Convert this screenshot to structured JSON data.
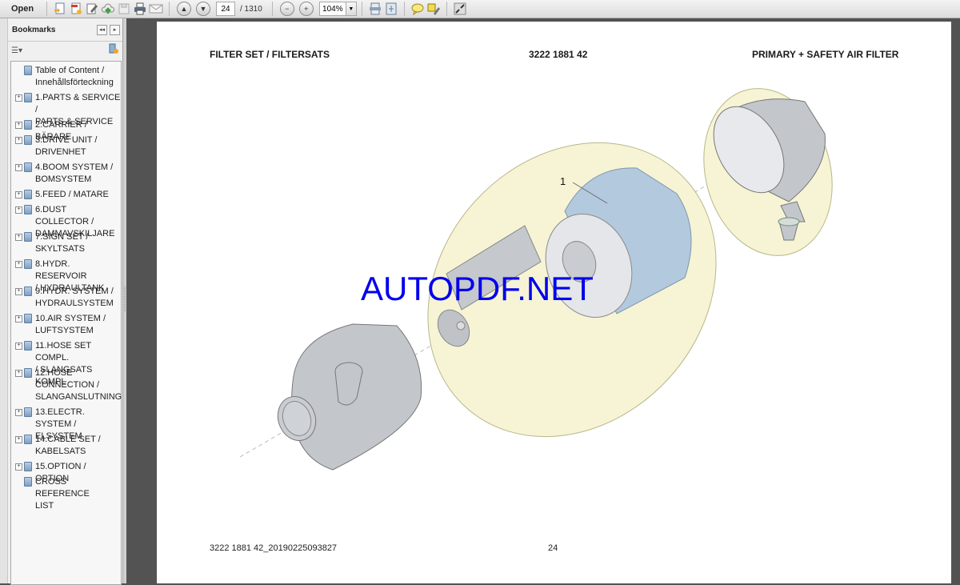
{
  "toolbar": {
    "open_label": "Open",
    "current_page": "24",
    "total_pages": "/ 1310",
    "zoom_level": "104%",
    "icons": [
      "folder-icon",
      "create-pdf-icon",
      "convert-icon",
      "edit-icon",
      "cloud-upload-icon",
      "save-icon",
      "print-icon",
      "email-icon",
      "previous-page-icon",
      "next-page-icon",
      "zoom-out-icon",
      "zoom-in-icon",
      "zoom-dropdown-icon",
      "fit-width-icon",
      "fit-page-icon",
      "comment-icon",
      "highlight-icon",
      "full-screen-icon"
    ]
  },
  "sidebar": {
    "title": "Bookmarks",
    "items": [
      {
        "label": "Table of Content /\nInnehållsförteckning",
        "expandable": false
      },
      {
        "label": "1.PARTS & SERVICE /\nPARTS & SERVICE",
        "expandable": true
      },
      {
        "label": "2.CARRIER / BÄRARE",
        "expandable": true
      },
      {
        "label": "3.DRIVE UNIT /\nDRIVENHET",
        "expandable": true
      },
      {
        "label": "4.BOOM SYSTEM /\nBOMSYSTEM",
        "expandable": true
      },
      {
        "label": "5.FEED / MATARE",
        "expandable": true
      },
      {
        "label": "6.DUST COLLECTOR /\nDAMMAVSKILJARE",
        "expandable": true
      },
      {
        "label": "7.SIGN SET /\nSKYLTSATS",
        "expandable": true
      },
      {
        "label": "8.HYDR. RESERVOIR\n/ HYDRAULTANK",
        "expandable": true
      },
      {
        "label": "9.HYDR. SYSTEM /\nHYDRAULSYSTEM",
        "expandable": true
      },
      {
        "label": "10.AIR SYSTEM /\nLUFTSYSTEM",
        "expandable": true
      },
      {
        "label": "11.HOSE SET COMPL.\n/ SLANGSATS KOMPL",
        "expandable": true
      },
      {
        "label": "12.HOSE\nCONNECTION /\nSLANGANSLUTNING",
        "expandable": true
      },
      {
        "label": "13.ELECTR. SYSTEM /\nELSYSTEM",
        "expandable": true
      },
      {
        "label": "14.CABLE SET /\nKABELSATS",
        "expandable": true
      },
      {
        "label": "15.OPTION / OPTION",
        "expandable": true
      },
      {
        "label": "CROSS REFERENCE\nLIST",
        "expandable": false
      }
    ]
  },
  "document": {
    "header_left": "FILTER SET / FILTERSATS",
    "header_center": "3222 1881 42",
    "header_right": "PRIMARY + SAFETY AIR FILTER",
    "callout_label": "1",
    "watermark": "AUTOPDF.NET",
    "footer_left": "3222 1881 42_20190225093827",
    "footer_page": "24",
    "colors": {
      "highlight_ellipse": "#f6f4d4",
      "filter_blue": "#b3c9de",
      "housing_gray": "#c3c7cc",
      "watermark": "#0000ee"
    }
  }
}
